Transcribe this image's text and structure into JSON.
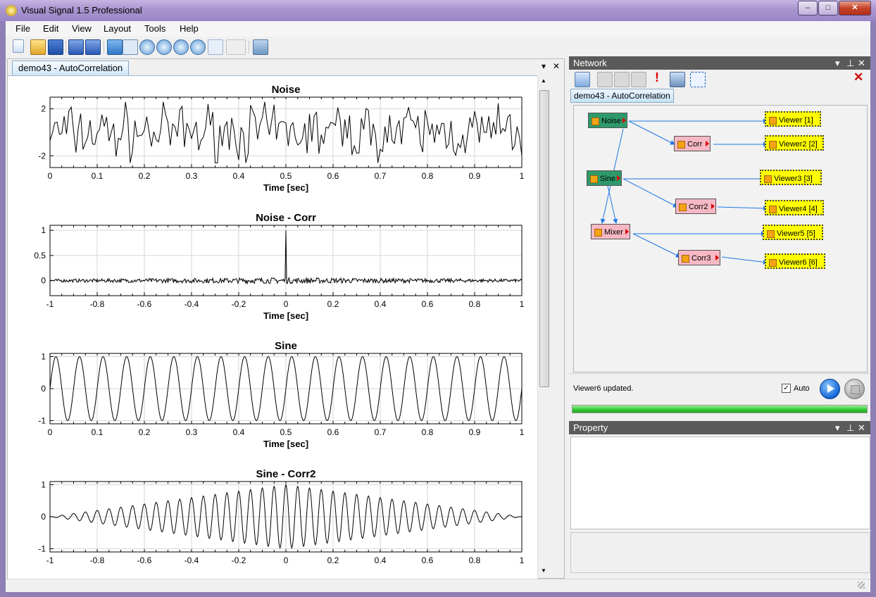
{
  "window": {
    "title": "Visual Signal 1.5 Professional",
    "controls": {
      "minimize": "–",
      "maximize": "□",
      "close": "✕"
    }
  },
  "menu": [
    "File",
    "Edit",
    "View",
    "Layout",
    "Tools",
    "Help"
  ],
  "doc_tab": {
    "label": "demo43 - AutoCorrelation",
    "dropdown": "▾",
    "close": "✕"
  },
  "chart_data": [
    {
      "type": "line",
      "title": "Noise",
      "xlabel": "Time [sec]",
      "xlim": [
        0,
        1
      ],
      "ylim": [
        -3,
        3
      ],
      "xticks": [
        "0",
        "0.1",
        "0.2",
        "0.3",
        "0.4",
        "0.5",
        "0.6",
        "0.7",
        "0.8",
        "0.9",
        "1"
      ],
      "yticks": [
        "2",
        "-2"
      ],
      "signal": "random noise, amplitude ≈ ±2"
    },
    {
      "type": "line",
      "title": "Noise - Corr",
      "xlabel": "Time [sec]",
      "xlim": [
        -1,
        1
      ],
      "ylim": [
        -0.3,
        1.1
      ],
      "xticks": [
        "-1",
        "-0.8",
        "-0.6",
        "-0.4",
        "-0.2",
        "0",
        "0.2",
        "0.4",
        "0.6",
        "0.8",
        "1"
      ],
      "yticks": [
        "1",
        "0.5",
        "0"
      ],
      "signal": "autocorrelation of noise; peak 1 at 0, residual ≈ ±0.05"
    },
    {
      "type": "line",
      "title": "Sine",
      "xlabel": "Time [sec]",
      "xlim": [
        0,
        1
      ],
      "ylim": [
        -1.1,
        1.1
      ],
      "xticks": [
        "0",
        "0.1",
        "0.2",
        "0.3",
        "0.4",
        "0.5",
        "0.6",
        "0.7",
        "0.8",
        "0.9",
        "1"
      ],
      "yticks": [
        "1",
        "0",
        "-1"
      ],
      "signal": "sine wave, 20 cycles per second, amplitude 1"
    },
    {
      "type": "line",
      "title": "Sine - Corr2",
      "xlabel": "",
      "xlim": [
        -1,
        1
      ],
      "ylim": [
        -1.1,
        1.1
      ],
      "xticks": [
        "-1",
        "-0.8",
        "-0.6",
        "-0.4",
        "-0.2",
        "0",
        "0.2",
        "0.4",
        "0.6",
        "0.8",
        "1"
      ],
      "yticks": [
        "1",
        "0",
        "-1"
      ],
      "signal": "autocorrelation of sine; cosine with triangular envelope, peak 1 at 0"
    }
  ],
  "network": {
    "title": "Network",
    "tab": "demo43 - AutoCorrelation",
    "nodes": [
      {
        "id": "noise",
        "label": "Noise",
        "kind": "source"
      },
      {
        "id": "sine",
        "label": "Sine",
        "kind": "source"
      },
      {
        "id": "corr",
        "label": "Corr",
        "kind": "process"
      },
      {
        "id": "corr2",
        "label": "Corr2",
        "kind": "process"
      },
      {
        "id": "mixer",
        "label": "Mixer",
        "kind": "process"
      },
      {
        "id": "corr3",
        "label": "Corr3",
        "kind": "process"
      },
      {
        "id": "v1",
        "label": "Viewer [1]",
        "kind": "viewer"
      },
      {
        "id": "v2",
        "label": "Viewer2 [2]",
        "kind": "viewer"
      },
      {
        "id": "v3",
        "label": "Viewer3 [3]",
        "kind": "viewer"
      },
      {
        "id": "v4",
        "label": "Viewer4 [4]",
        "kind": "viewer"
      },
      {
        "id": "v5",
        "label": "Viewer5 [5]",
        "kind": "viewer"
      },
      {
        "id": "v6",
        "label": "Viewer6 [6]",
        "kind": "viewer"
      }
    ],
    "status": "Viewer6 updated.",
    "auto_label": "Auto",
    "progress": 1.0
  },
  "property": {
    "title": "Property"
  },
  "colors": {
    "source": "#2e9a6b",
    "process": "#f6b8c4",
    "viewer": "#ffff00",
    "link": "#1e78e6",
    "progress": "#3ccf3c"
  }
}
